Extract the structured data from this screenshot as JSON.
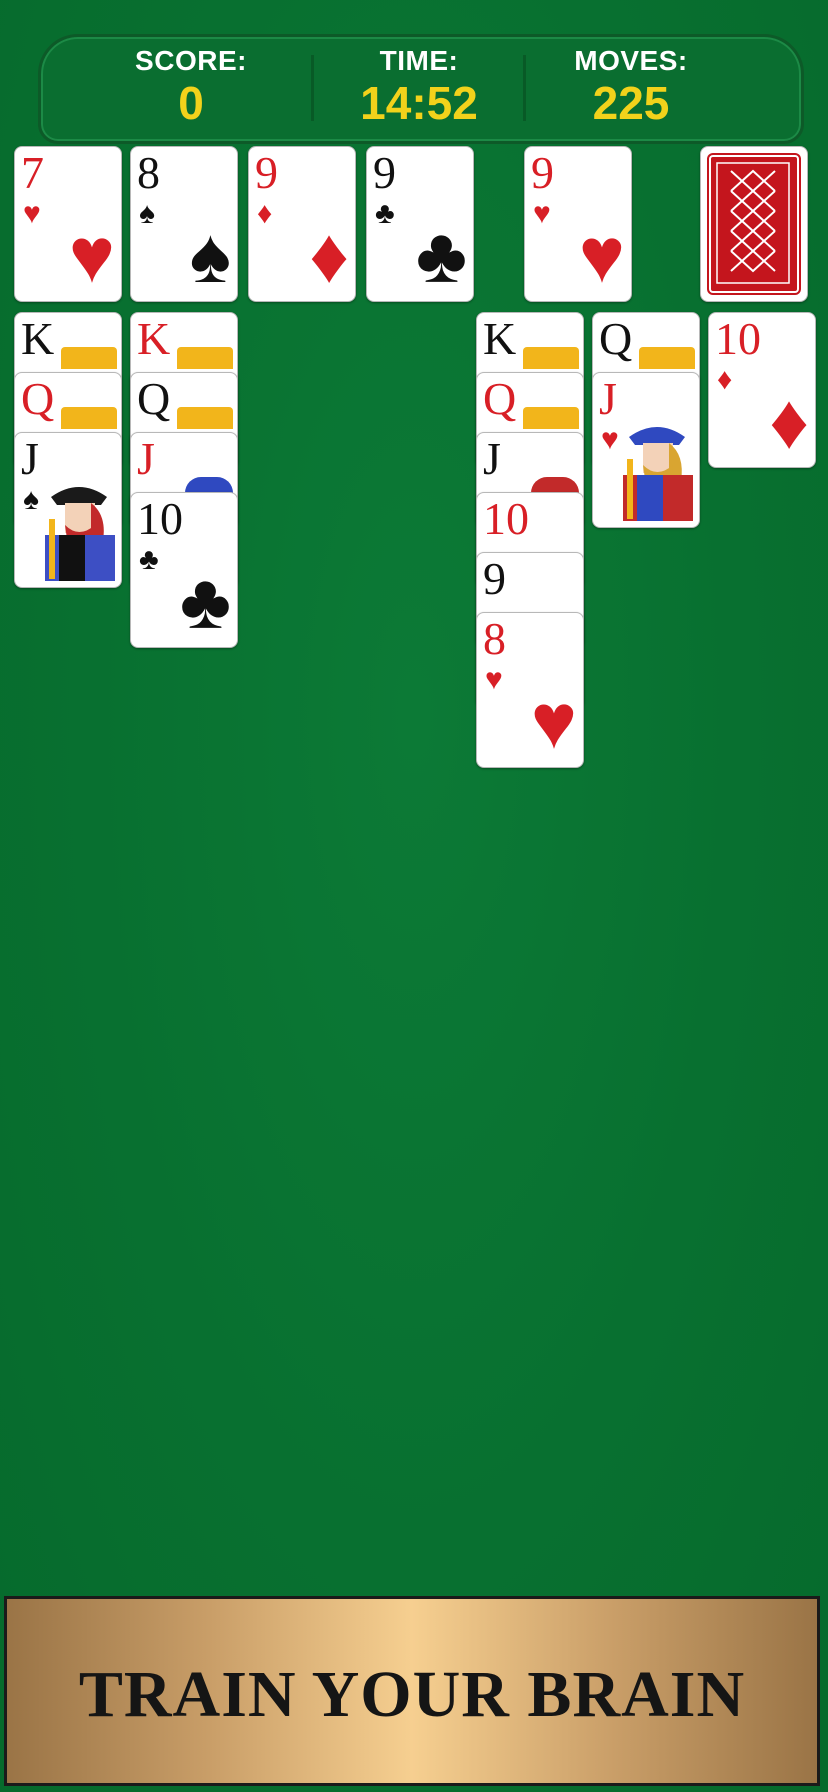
{
  "hud": {
    "score_label": "SCORE:",
    "score_value": "0",
    "time_label": "TIME:",
    "time_value": "14:52",
    "moves_label": "MOVES:",
    "moves_value": "225"
  },
  "foundations": [
    {
      "rank": "7",
      "suit": "♥",
      "color": "red"
    },
    {
      "rank": "8",
      "suit": "♠",
      "color": "black"
    },
    {
      "rank": "9",
      "suit": "♦",
      "color": "red"
    },
    {
      "rank": "9",
      "suit": "♣",
      "color": "black"
    }
  ],
  "waste": {
    "rank": "9",
    "suit": "♥",
    "color": "red"
  },
  "stock": {
    "icon": "card-back-icon"
  },
  "tableau": {
    "col1": [
      {
        "rank": "K",
        "suit": "♣",
        "color": "black"
      },
      {
        "rank": "Q",
        "suit": "♥",
        "color": "red"
      },
      {
        "rank": "J",
        "suit": "♠",
        "color": "black"
      }
    ],
    "col2": [
      {
        "rank": "K",
        "suit": "♥",
        "color": "red"
      },
      {
        "rank": "Q",
        "suit": "♠",
        "color": "black"
      },
      {
        "rank": "J",
        "suit": "♦",
        "color": "red"
      },
      {
        "rank": "10",
        "suit": "♣",
        "color": "black"
      }
    ],
    "col5": [
      {
        "rank": "K",
        "suit": "♣",
        "color": "black"
      },
      {
        "rank": "Q",
        "suit": "♥",
        "color": "red"
      },
      {
        "rank": "J",
        "suit": "♠",
        "color": "black"
      },
      {
        "rank": "10",
        "suit": "♥",
        "color": "red"
      },
      {
        "rank": "9",
        "suit": "♠",
        "color": "black"
      },
      {
        "rank": "8",
        "suit": "♥",
        "color": "red"
      }
    ],
    "col6": [
      {
        "rank": "Q",
        "suit": "♠",
        "color": "black"
      },
      {
        "rank": "J",
        "suit": "♥",
        "color": "red"
      }
    ],
    "col7": [
      {
        "rank": "10",
        "suit": "♦",
        "color": "red"
      }
    ]
  },
  "banner": {
    "text": "TRAIN YOUR BRAIN"
  },
  "colors": {
    "felt": "#087030",
    "accent": "#f2d21b",
    "red": "#d81f26",
    "banner_gold": "#f6cf90"
  }
}
